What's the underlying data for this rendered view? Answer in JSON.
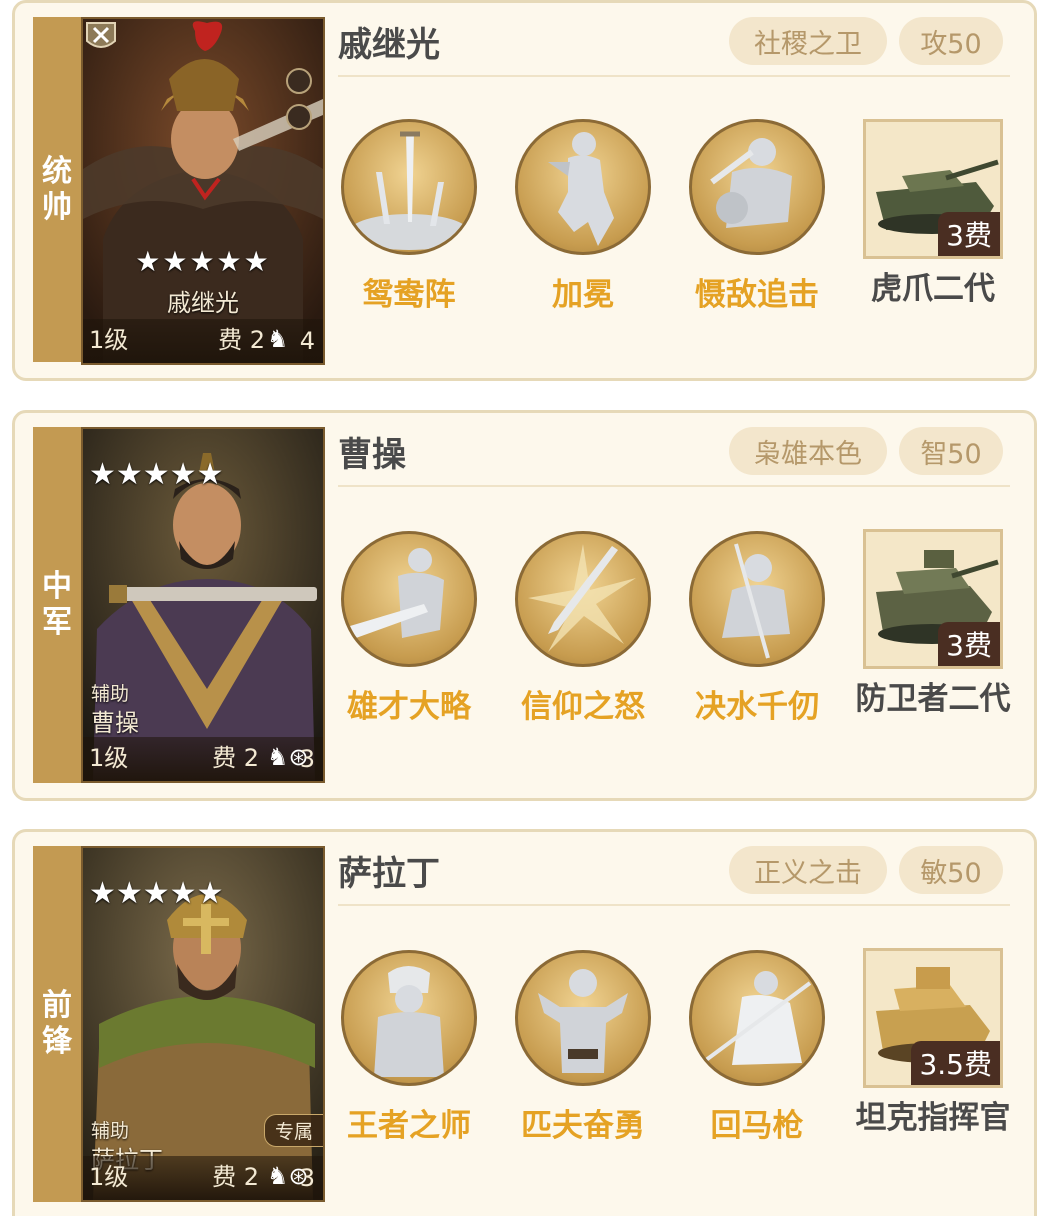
{
  "generals": [
    {
      "role": "统帅",
      "name": "戚继光",
      "portrait_name": "戚继光",
      "stars": "★★★★★",
      "aux_label": "",
      "exclusive": "",
      "level": "1级",
      "cost": "费 2",
      "troop": "4",
      "tag1": "社稷之卫",
      "tag2": "攻50",
      "skills": [
        "鸳鸯阵",
        "加冕",
        "慑敌追击"
      ],
      "unit": {
        "name": "虎爪二代",
        "cost": "3费"
      }
    },
    {
      "role": "中军",
      "name": "曹操",
      "portrait_name": "曹操",
      "stars": "★★★★★",
      "aux_label": "辅助",
      "exclusive": "",
      "level": "1级",
      "cost": "费 2",
      "troop": "3",
      "tag1": "枭雄本色",
      "tag2": "智50",
      "skills": [
        "雄才大略",
        "信仰之怒",
        "决水千仞"
      ],
      "unit": {
        "name": "防卫者二代",
        "cost": "3费"
      }
    },
    {
      "role": "前锋",
      "name": "萨拉丁",
      "portrait_name": "萨拉丁",
      "stars": "★★★★★",
      "aux_label": "辅助",
      "exclusive": "专属",
      "level": "1级",
      "cost": "费 2",
      "troop": "3",
      "tag1": "正义之击",
      "tag2": "敏50",
      "skills": [
        "王者之师",
        "匹夫奋勇",
        "回马枪"
      ],
      "unit": {
        "name": "坦克指挥官",
        "cost": "3.5费"
      }
    }
  ],
  "colors": {
    "card_bg": "#fdf8ec",
    "role_bg": "#c39a52",
    "skill_text": "#e5a224",
    "tag_text": "#b5986a"
  },
  "icons": {
    "troop_single": "horse-icon",
    "troop_multi": "horse-wheel-icon",
    "badge": "crossed-swords-icon"
  }
}
